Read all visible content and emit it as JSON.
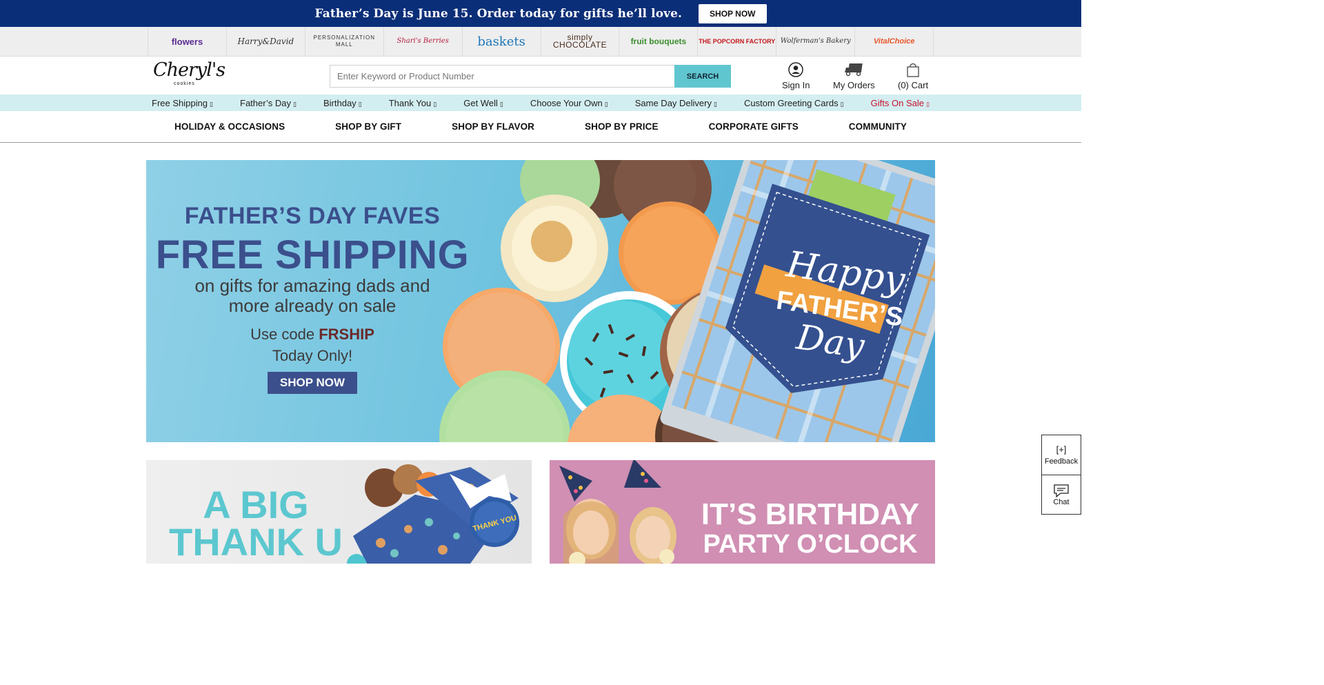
{
  "promo": {
    "text": "Father’s Day is June 15. Order today for gifts he’ll love.",
    "button": "SHOP NOW",
    "bg_color": "#0b2e78"
  },
  "brands": [
    {
      "name": "1-800-flowers.com",
      "label": "flowers"
    },
    {
      "name": "Harry & David",
      "label": "Harry&David"
    },
    {
      "name": "Personalization Mall",
      "label": "PERSONALIZATION MALL"
    },
    {
      "name": "Shari's Berries",
      "label": "Shari's Berries"
    },
    {
      "name": "1-800-baskets.com",
      "label": "baskets"
    },
    {
      "name": "Simply Chocolate",
      "label": "simply CHOCOLATE"
    },
    {
      "name": "Fruit Bouquets",
      "label": "fruit bouquets"
    },
    {
      "name": "The Popcorn Factory",
      "label": "THE POPCORN FACTORY"
    },
    {
      "name": "Wolferman's Bakery",
      "label": "Wolferman's Bakery"
    },
    {
      "name": "Vital Choice",
      "label": "VitalChoice"
    }
  ],
  "header": {
    "logo_main": "Cheryl's",
    "logo_sub": "cookies",
    "search_placeholder": "Enter Keyword or Product Number",
    "search_button": "SEARCH",
    "sign_in": "Sign In",
    "my_orders": "My Orders",
    "cart": "(0) Cart"
  },
  "quick_links": [
    {
      "label": "Free Shipping",
      "chevron": "▯"
    },
    {
      "label": "Father’s Day",
      "chevron": "▯"
    },
    {
      "label": "Birthday",
      "chevron": "▯"
    },
    {
      "label": "Thank You",
      "chevron": "▯"
    },
    {
      "label": "Get Well",
      "chevron": "▯"
    },
    {
      "label": "Choose Your Own",
      "chevron": "▯"
    },
    {
      "label": "Same Day Delivery",
      "chevron": "▯"
    },
    {
      "label": "Custom Greeting Cards",
      "chevron": "▯"
    },
    {
      "label": "Gifts On Sale",
      "chevron": "▯"
    }
  ],
  "main_nav": [
    "HOLIDAY & OCCASIONS",
    "SHOP BY GIFT",
    "SHOP BY FLAVOR",
    "SHOP BY PRICE",
    "CORPORATE GIFTS",
    "COMMUNITY"
  ],
  "hero": {
    "line1": "FATHER’S DAY FAVES",
    "line2": "FREE SHIPPING",
    "line3a": "on gifts for amazing dads and",
    "line3b": "more already on sale",
    "code_prefix": "Use code ",
    "code": "FRSHIP",
    "line5": "Today Only!",
    "button": "SHOP NOW",
    "card_line1": "Happy",
    "card_line2": "FATHER’S",
    "card_line3": "Day"
  },
  "tiles": {
    "left_line1": "A BIG",
    "left_line2": "THANK U",
    "thank_you_sticker": "THANK YOU",
    "right_line1": "IT’S BIRTHDAY",
    "right_line2": "PARTY O’CLOCK"
  },
  "side_widgets": {
    "feedback_icon": "[+]",
    "feedback": "Feedback",
    "chat": "Chat"
  },
  "colors": {
    "accent_teal": "#5fc6cf",
    "quick_bar_bg": "#d3eef1",
    "sale_red": "#c8102e",
    "hero_navy": "#3b4f8c"
  }
}
